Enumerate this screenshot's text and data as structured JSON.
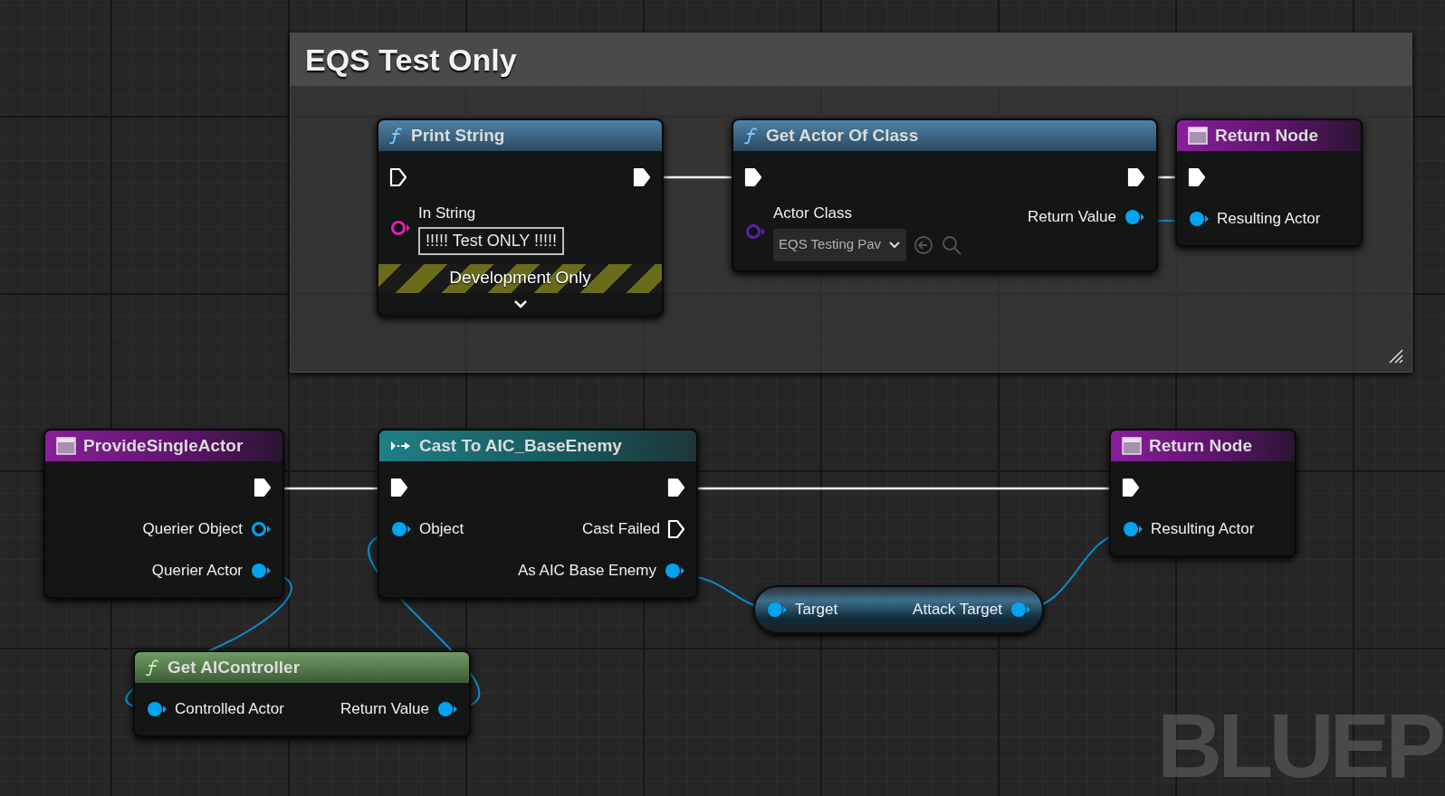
{
  "comment": {
    "title": "EQS Test Only"
  },
  "nodes": [
    {
      "kind": "function",
      "title": "Print String",
      "rows": [
        {
          "left": {
            "kind": "exec",
            "connected": false
          },
          "right": {
            "kind": "exec",
            "connected": true
          }
        },
        {
          "left": {
            "kind": "string",
            "connected": false,
            "label": "In String"
          },
          "field": "!!!!! Test ONLY !!!!!"
        }
      ],
      "banner": "Development Only",
      "expanded": false
    },
    {
      "kind": "function",
      "title": "Get Actor Of Class",
      "rows": [
        {
          "left": {
            "kind": "exec",
            "connected": true
          },
          "right": {
            "kind": "exec",
            "connected": true
          }
        },
        {
          "left": {
            "kind": "class",
            "connected": false,
            "label": "Actor Class"
          },
          "dropdown": "EQS Testing Pav",
          "right": {
            "kind": "object",
            "connected": true,
            "label": "Return Value"
          }
        }
      ]
    },
    {
      "kind": "return",
      "title": "Return Node",
      "rows": [
        {
          "left": {
            "kind": "exec",
            "connected": true
          }
        },
        {
          "left": {
            "kind": "object",
            "connected": true,
            "label": "Resulting Actor"
          }
        }
      ]
    },
    {
      "kind": "return",
      "title": "ProvideSingleActor",
      "rows": [
        {
          "right": {
            "kind": "exec",
            "connected": true
          }
        },
        {
          "right": {
            "kind": "object",
            "connected": false,
            "label": "Querier Object"
          }
        },
        {
          "right": {
            "kind": "object",
            "connected": true,
            "label": "Querier Actor"
          }
        }
      ]
    },
    {
      "kind": "cast",
      "title": "Cast To AIC_BaseEnemy",
      "rows": [
        {
          "left": {
            "kind": "exec",
            "connected": true
          },
          "right": {
            "kind": "exec",
            "connected": true
          }
        },
        {
          "left": {
            "kind": "object",
            "connected": true,
            "label": "Object"
          },
          "right": {
            "kind": "exec",
            "connected": false,
            "label": "Cast Failed"
          }
        },
        {
          "right": {
            "kind": "object",
            "connected": true,
            "label": "As AIC Base Enemy"
          }
        }
      ]
    },
    {
      "kind": "return",
      "title": "Return Node",
      "rows": [
        {
          "left": {
            "kind": "exec",
            "connected": true
          }
        },
        {
          "left": {
            "kind": "object",
            "connected": true,
            "label": "Resulting Actor"
          }
        }
      ]
    },
    {
      "kind": "variable",
      "rows": [
        {
          "left": {
            "kind": "object",
            "connected": true,
            "label": "Target"
          },
          "right": {
            "kind": "object",
            "connected": true,
            "label": "Attack Target"
          }
        }
      ]
    },
    {
      "kind": "pure",
      "title": "Get AIController",
      "rows": [
        {
          "left": {
            "kind": "object",
            "connected": true,
            "label": "Controlled Actor"
          },
          "right": {
            "kind": "object",
            "connected": true,
            "label": "Return Value"
          }
        }
      ]
    }
  ],
  "overlay_text": "BLUEP"
}
